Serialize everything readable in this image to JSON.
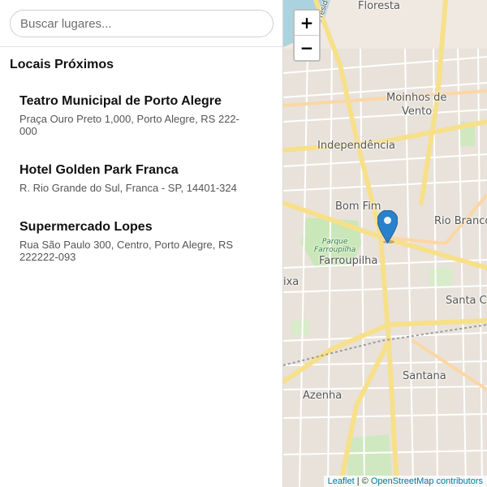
{
  "search": {
    "placeholder": "Buscar lugares..."
  },
  "sidebar": {
    "title": "Locais Próximos",
    "places": [
      {
        "name": "Teatro Municipal de Porto Alegre",
        "address": "Praça Ouro Preto 1,000, Porto Alegre, RS 222-000"
      },
      {
        "name": "Hotel Golden Park Franca",
        "address": "R. Rio Grande do Sul, Franca - SP, 14401-324"
      },
      {
        "name": "Supermercado Lopes",
        "address": "Rua São Paulo 300, Centro, Porto Alegre, RS 222222-093"
      }
    ]
  },
  "map": {
    "zoom_in_label": "+",
    "zoom_out_label": "−",
    "labels": {
      "floresta": "Floresta",
      "avenida": "Avenida Presidente",
      "moinhos_line1": "Moinhos de",
      "moinhos_line2": "Vento",
      "independencia": "Independência",
      "bom_fim": "Bom Fim",
      "rio_branco": "Rio Branco",
      "parque_line1": "Parque",
      "parque_line2": "Farroupilha",
      "farroupilha": "Farroupilha",
      "ixa": "ixa",
      "santa_c": "Santa C",
      "santana": "Santana",
      "azenha": "Azenha"
    },
    "attribution": {
      "leaflet": "Leaflet",
      "separator": " | © ",
      "osm": "OpenStreetMap contributors"
    },
    "marker_color": "#2a81cb"
  }
}
